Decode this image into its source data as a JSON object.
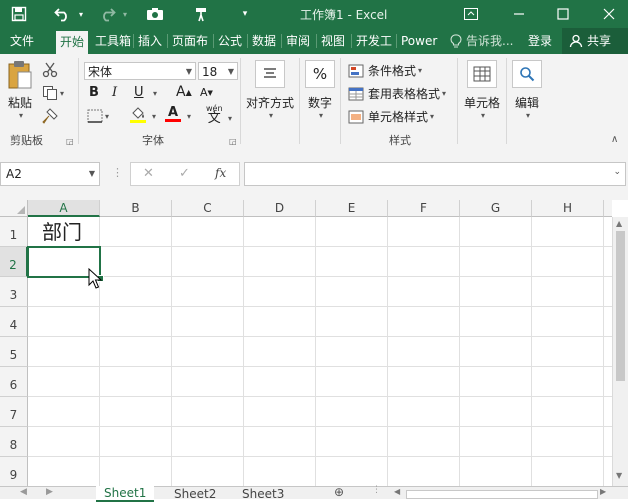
{
  "app": {
    "window_title": "工作簿1 - Excel",
    "colors": {
      "brand": "#217346",
      "ribbon_bg": "#f3f3f3"
    }
  },
  "titlebar": {
    "icons": [
      "save-icon",
      "undo-icon",
      "redo-icon",
      "camera-icon",
      "format-painter-icon",
      "customize-icon",
      "ribbon-display-icon",
      "minimize-icon",
      "maximize-icon",
      "close-icon"
    ]
  },
  "tabs": [
    {
      "label": "文件"
    },
    {
      "label": "开始",
      "active": true
    },
    {
      "label": "工具箱"
    },
    {
      "label": "插入"
    },
    {
      "label": "页面布"
    },
    {
      "label": "公式"
    },
    {
      "label": "数据"
    },
    {
      "label": "审阅"
    },
    {
      "label": "视图"
    },
    {
      "label": "开发工"
    },
    {
      "label": "Power"
    }
  ],
  "tell_me": "告诉我...",
  "login": "登录",
  "share": "共享",
  "ribbon": {
    "clipboard": {
      "paste": "粘贴",
      "group": "剪贴板"
    },
    "font": {
      "name": "宋体",
      "size": "18",
      "bold": "B",
      "italic": "I",
      "underline": "U",
      "grow": "A",
      "shrink": "A",
      "color_letter": "A",
      "phonetic": "wén",
      "group": "字体",
      "colors": {
        "fill": "#ffff00",
        "font": "#ff0000"
      }
    },
    "alignment": {
      "label": "对齐方式"
    },
    "number": {
      "label": "数字",
      "symbol": "%"
    },
    "styles": {
      "conditional": "条件格式",
      "table": "套用表格格式",
      "cell_styles": "单元格样式",
      "group": "样式"
    },
    "cells": {
      "label": "单元格"
    },
    "editing": {
      "label": "编辑"
    }
  },
  "formula_bar": {
    "name_box": "A2",
    "cancel": "✕",
    "enter": "✓",
    "fx": "fx",
    "value": ""
  },
  "grid": {
    "columns": [
      "A",
      "B",
      "C",
      "D",
      "E",
      "F",
      "G",
      "H"
    ],
    "rows": [
      "1",
      "2",
      "3",
      "4",
      "5",
      "6",
      "7",
      "8",
      "9"
    ],
    "cells": {
      "A1": "部门"
    },
    "selected": "A2"
  },
  "sheets": [
    {
      "label": "Sheet1",
      "active": true
    },
    {
      "label": "Sheet2"
    },
    {
      "label": "Sheet3"
    }
  ]
}
